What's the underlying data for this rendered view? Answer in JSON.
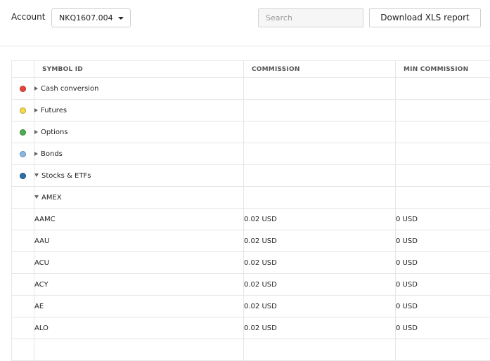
{
  "header": {
    "account_label": "Account",
    "account_value": "NKQ1607.004",
    "search_placeholder": "Search",
    "download_label": "Download XLS report"
  },
  "table": {
    "columns": [
      "SYMBOL ID",
      "COMMISSION",
      "MIN COMMISSION"
    ],
    "groups": [
      {
        "label": "Cash conversion",
        "color": "#e8443a",
        "expanded": false
      },
      {
        "label": "Futures",
        "color": "#f6d84a",
        "expanded": false
      },
      {
        "label": "Options",
        "color": "#4cb050",
        "expanded": false
      },
      {
        "label": "Bonds",
        "color": "#8ab8e6",
        "expanded": false
      },
      {
        "label": "Stocks & ETFs",
        "color": "#2b6ea8",
        "expanded": true
      }
    ],
    "subgroup": {
      "label": "AMEX",
      "expanded": true
    },
    "rows": [
      {
        "symbol": "AAMC",
        "commission": "0.02 USD",
        "min_commission": "0 USD"
      },
      {
        "symbol": "AAU",
        "commission": "0.02 USD",
        "min_commission": "0 USD"
      },
      {
        "symbol": "ACU",
        "commission": "0.02 USD",
        "min_commission": "0 USD"
      },
      {
        "symbol": "ACY",
        "commission": "0.02 USD",
        "min_commission": "0 USD"
      },
      {
        "symbol": "AE",
        "commission": "0.02 USD",
        "min_commission": "0 USD"
      },
      {
        "symbol": "ALO",
        "commission": "0.02 USD",
        "min_commission": "0 USD"
      }
    ]
  }
}
